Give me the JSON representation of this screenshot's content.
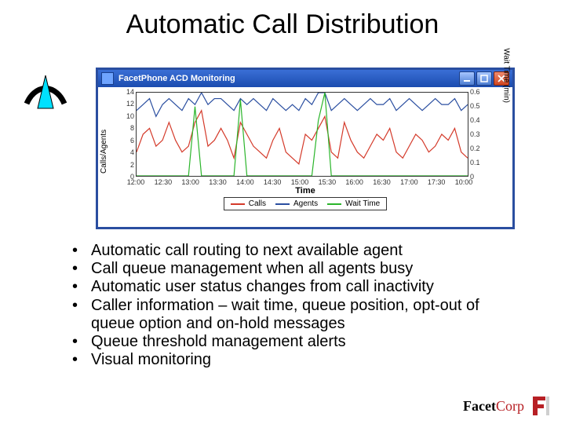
{
  "title": "Automatic Call Distribution",
  "window": {
    "title": "FacetPhone ACD Monitoring"
  },
  "chart_data": {
    "type": "line",
    "xlabel": "Time",
    "y_left_label": "Calls/Agents",
    "y_right_label": "Wait Time (min)",
    "y_left_ticks": [
      0,
      2,
      4,
      6,
      8,
      10,
      12,
      14
    ],
    "y_right_ticks": [
      0,
      0.1,
      0.2,
      0.3,
      0.4,
      0.5,
      0.6
    ],
    "ylim_left": [
      0,
      14
    ],
    "ylim_right": [
      0,
      0.6
    ],
    "x_ticks": [
      "12:00",
      "12:30",
      "13:00",
      "13:30",
      "14:00",
      "14:30",
      "15:00",
      "15:30",
      "16:00",
      "16:30",
      "17:00",
      "17:30",
      "10:00"
    ],
    "legend": [
      {
        "name": "Calls",
        "color": "#d43a2a"
      },
      {
        "name": "Agents",
        "color": "#2a4ea0"
      },
      {
        "name": "Wait Time",
        "color": "#2bb52b"
      }
    ],
    "series": [
      {
        "name": "Agents",
        "axis": "left",
        "color": "#2a4ea0",
        "y": [
          11,
          12,
          13,
          10,
          12,
          13,
          12,
          11,
          13,
          12,
          14,
          12,
          13,
          13,
          12,
          11,
          13,
          12,
          13,
          12,
          11,
          13,
          12,
          11,
          12,
          11,
          13,
          12,
          14,
          14,
          11,
          12,
          13,
          12,
          11,
          12,
          13,
          12,
          12,
          13,
          11,
          12,
          13,
          12,
          11,
          12,
          13,
          12,
          12,
          13,
          11,
          12
        ]
      },
      {
        "name": "Calls",
        "axis": "left",
        "color": "#d43a2a",
        "y": [
          4,
          7,
          8,
          5,
          6,
          9,
          6,
          4,
          5,
          9,
          11,
          5,
          6,
          8,
          6,
          3,
          9,
          7,
          5,
          4,
          3,
          6,
          8,
          4,
          3,
          2,
          7,
          6,
          8,
          10,
          4,
          3,
          9,
          6,
          4,
          3,
          5,
          7,
          6,
          8,
          4,
          3,
          5,
          7,
          6,
          4,
          5,
          7,
          6,
          8,
          4,
          3
        ]
      },
      {
        "name": "Wait Time",
        "axis": "right",
        "color": "#2bb52b",
        "y": [
          0,
          0,
          0,
          0,
          0,
          0,
          0,
          0,
          0,
          0.5,
          0,
          0,
          0,
          0,
          0,
          0,
          0.55,
          0,
          0,
          0,
          0,
          0,
          0,
          0,
          0,
          0,
          0,
          0,
          0.4,
          0.6,
          0,
          0,
          0,
          0,
          0,
          0,
          0,
          0,
          0,
          0,
          0,
          0,
          0,
          0,
          0,
          0,
          0,
          0,
          0,
          0,
          0,
          0
        ]
      }
    ]
  },
  "bullets": [
    "Automatic call routing to next available agent",
    "Call queue management when all agents busy",
    "Automatic user status changes from call inactivity",
    "Caller information – wait time, queue position, opt-out of queue option and on-hold messages",
    "Queue threshold management alerts",
    "Visual monitoring"
  ],
  "brand": {
    "pre": "Facet",
    "em": "Corp"
  }
}
